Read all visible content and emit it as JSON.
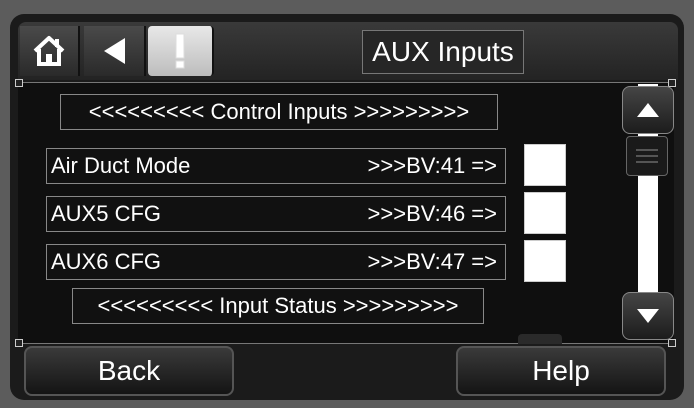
{
  "header": {
    "title": "AUX Inputs",
    "home_icon": "home-icon",
    "back_icon": "back-arrow-icon",
    "alert_icon": "alert-exclamation-icon"
  },
  "sections": {
    "control_inputs": "<<<<<<<<< Control Inputs >>>>>>>>>",
    "input_status": "<<<<<<<<< Input Status >>>>>>>>>"
  },
  "rows": [
    {
      "label": "Air Duct Mode",
      "value": ">>>BV:41 =>",
      "checked": false
    },
    {
      "label": "AUX5 CFG",
      "value": ">>>BV:46 =>",
      "checked": false
    },
    {
      "label": "AUX6 CFG",
      "value": ">>>BV:47 =>",
      "checked": false
    }
  ],
  "footer": {
    "back_label": "Back",
    "help_label": "Help"
  },
  "colors": {
    "background": "#1b1b1b",
    "text": "#ffffff",
    "checkbox": "#ffffff"
  }
}
